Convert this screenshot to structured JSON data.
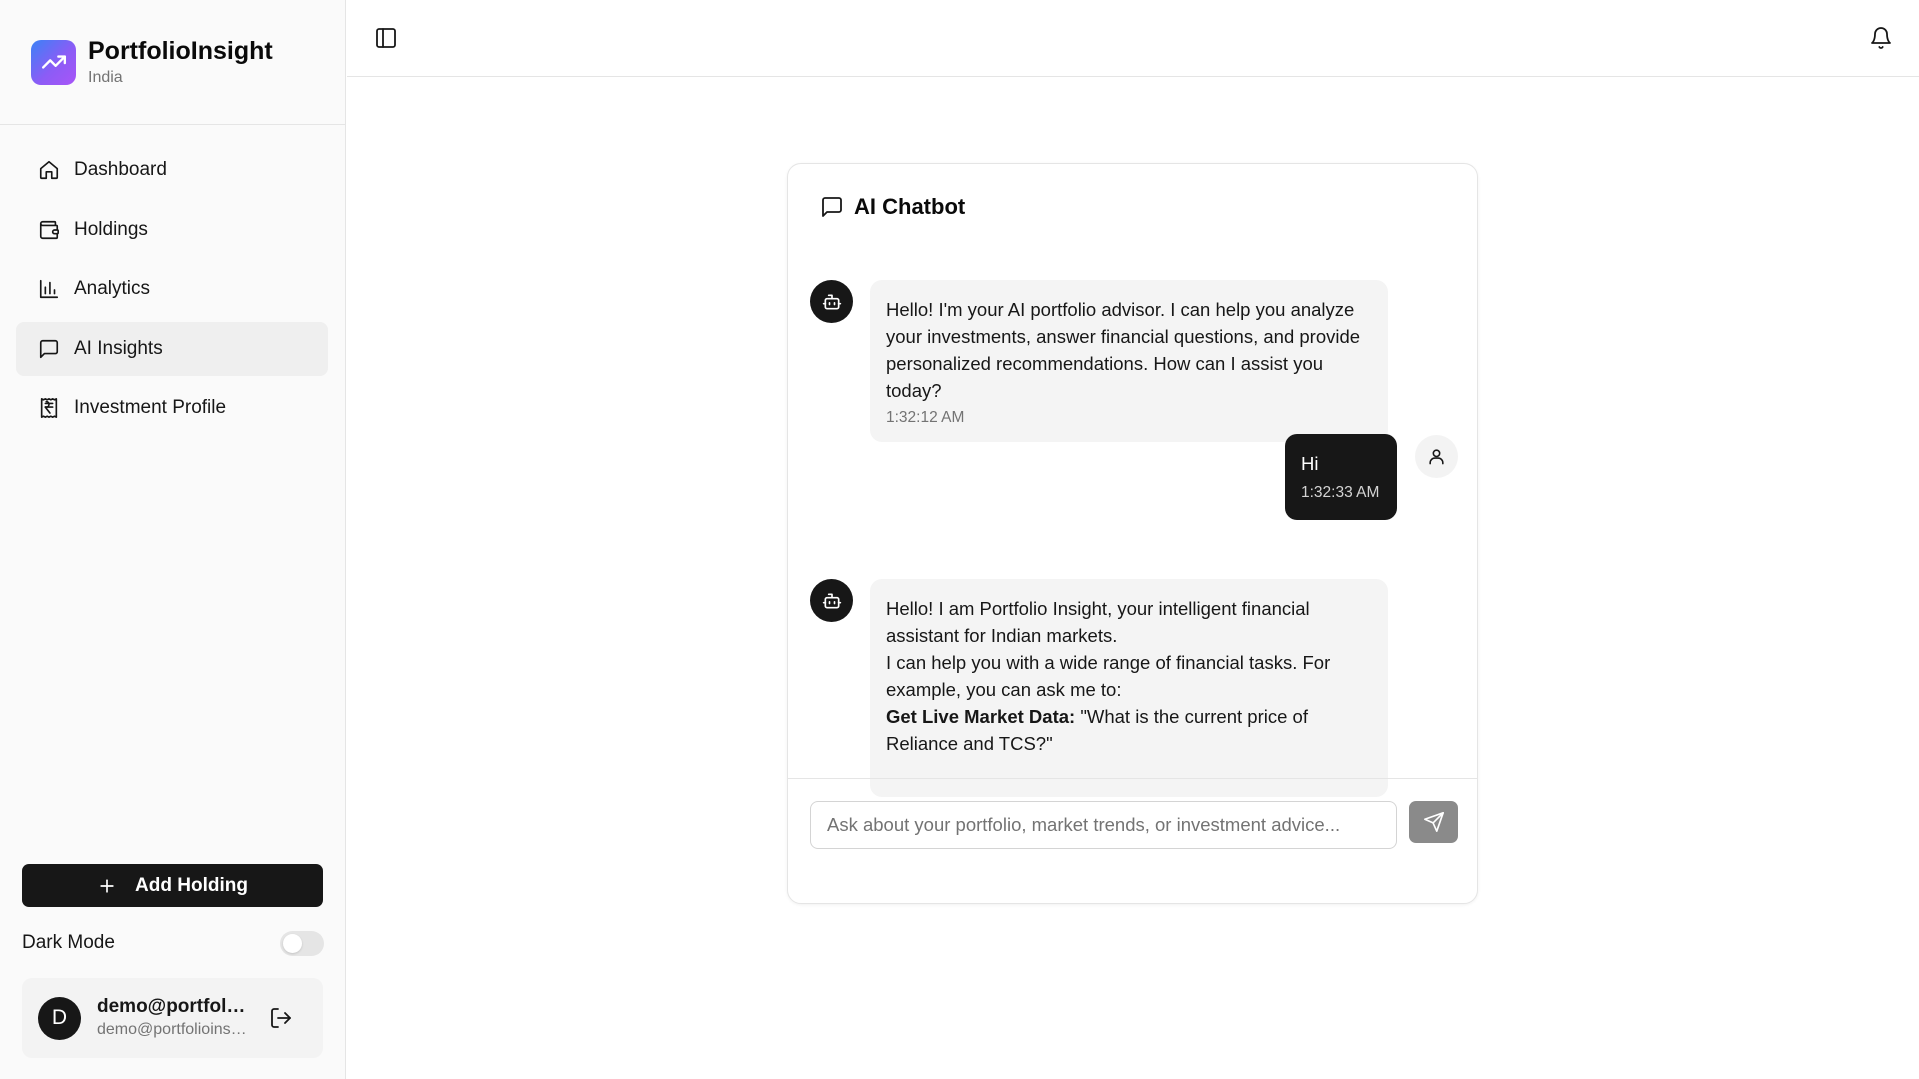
{
  "brand": {
    "name": "PortfolioInsight",
    "region": "India",
    "logo_icon": "trending-up-icon",
    "logo_gradient": [
      "#3b82f6",
      "#a855f7"
    ]
  },
  "nav": {
    "items": [
      {
        "label": "Dashboard",
        "icon": "home-icon",
        "active": false
      },
      {
        "label": "Holdings",
        "icon": "wallet-icon",
        "active": false
      },
      {
        "label": "Analytics",
        "icon": "bar-chart-icon",
        "active": false
      },
      {
        "label": "AI Insights",
        "icon": "message-square-icon",
        "active": true
      },
      {
        "label": "Investment Profile",
        "icon": "rupee-receipt-icon",
        "active": false
      }
    ]
  },
  "sidebar_footer": {
    "add_holding_label": "Add Holding",
    "dark_mode_label": "Dark Mode",
    "dark_mode_on": false,
    "user": {
      "initial": "D",
      "name": "demo@portfolioinsight.com",
      "email": "demo@portfolioinsight.com"
    }
  },
  "chat": {
    "title": "AI Chatbot",
    "messages": [
      {
        "role": "assistant",
        "text": "Hello! I'm your AI portfolio advisor. I can help you analyze your investments, answer financial questions, and provide personalized recommendations. How can I assist you today?",
        "time": "1:32:12 AM"
      },
      {
        "role": "user",
        "text": "Hi",
        "time": "1:32:33 AM"
      },
      {
        "role": "assistant",
        "line1": "Hello! I am Portfolio Insight, your intelligent financial assistant for Indian markets.",
        "line2": "I can help you with a wide range of financial tasks. For example, you can ask me to:",
        "bold": "Get Live Market Data:",
        "rest": " \"What is the current price of Reliance and TCS?\""
      }
    ],
    "input": {
      "value": "",
      "placeholder": "Ask about your portfolio, market trends, or investment advice..."
    },
    "send_icon": "send-icon"
  },
  "colors": {
    "primary": "#171717",
    "sidebar_bg": "#fafafa",
    "bot_bubble": "#f4f4f4",
    "send_disabled": "#8a8a8a"
  }
}
